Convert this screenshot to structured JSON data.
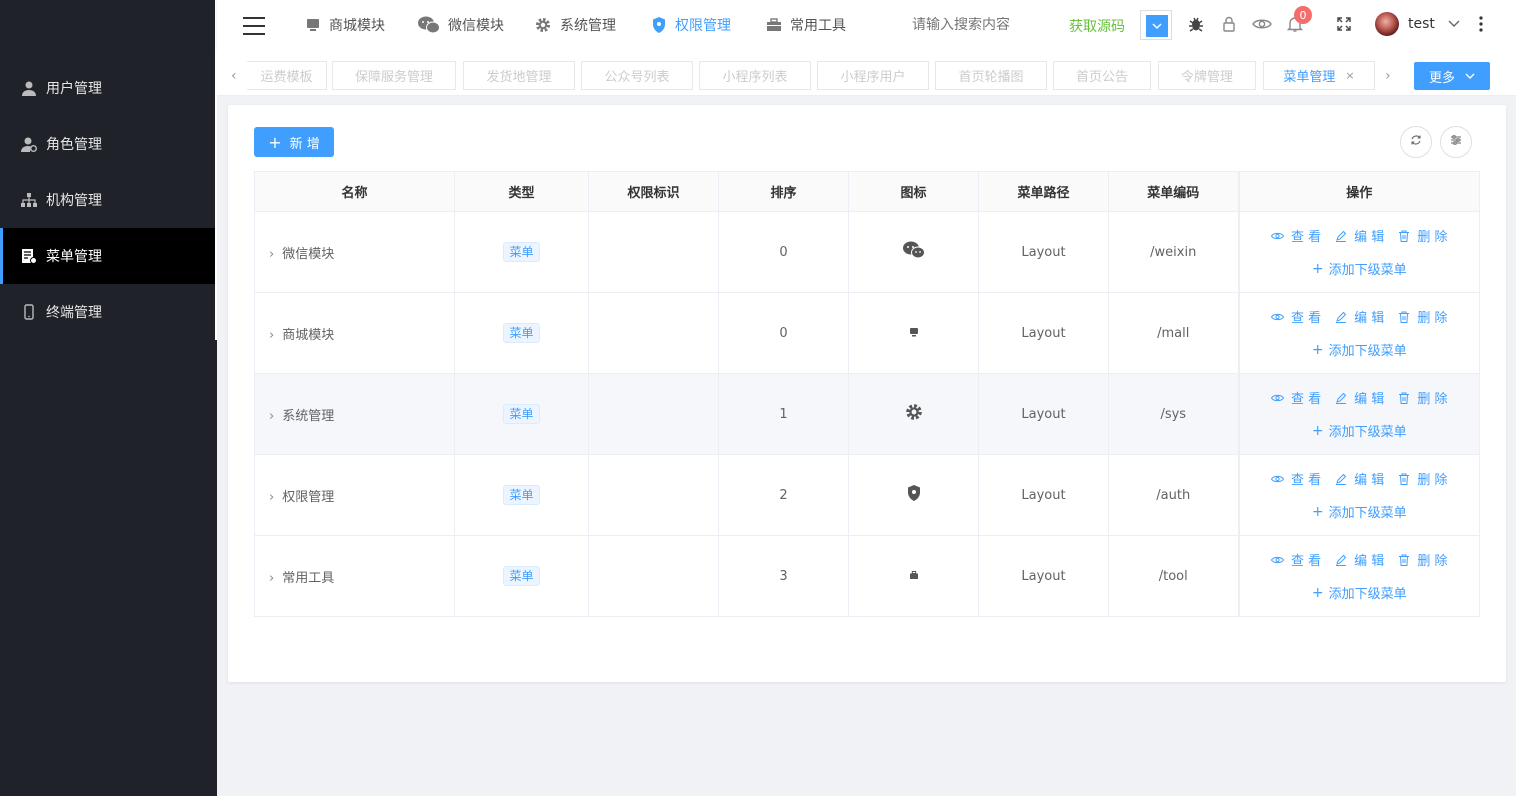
{
  "colors": {
    "primary": "#409eff",
    "success": "#67c23a",
    "danger": "#f56c6c",
    "sidebar_bg": "#20222a"
  },
  "sidebar": {
    "items": [
      {
        "label": "用户管理",
        "icon": "user-icon"
      },
      {
        "label": "角色管理",
        "icon": "role-icon"
      },
      {
        "label": "机构管理",
        "icon": "org-tree-icon"
      },
      {
        "label": "菜单管理",
        "icon": "menu-doc-icon",
        "active": true
      },
      {
        "label": "终端管理",
        "icon": "mobile-icon"
      }
    ]
  },
  "header": {
    "nav": [
      {
        "label": "商城模块",
        "icon": "monitor-icon"
      },
      {
        "label": "微信模块",
        "icon": "wechat-icon"
      },
      {
        "label": "系统管理",
        "icon": "gear-icon"
      },
      {
        "label": "权限管理",
        "icon": "shield-icon",
        "active": true
      },
      {
        "label": "常用工具",
        "icon": "toolbox-icon"
      }
    ],
    "search_placeholder": "请输入搜索内容",
    "get_source": "获取源码",
    "notification_count": "0",
    "username": "test"
  },
  "tabs": {
    "items": [
      "运费模板",
      "保障服务管理",
      "发货地管理",
      "公众号列表",
      "小程序列表",
      "小程序用户",
      "首页轮播图",
      "首页公告",
      "令牌管理",
      "菜单管理"
    ],
    "active": "菜单管理",
    "close": "×",
    "more": "更多"
  },
  "toolbar": {
    "add_label": "新 增"
  },
  "table": {
    "columns": [
      "名称",
      "类型",
      "权限标识",
      "排序",
      "图标",
      "菜单路径",
      "菜单编码",
      "操作"
    ],
    "rows": [
      {
        "name": "微信模块",
        "type": "菜单",
        "perm": "",
        "sort": "0",
        "icon": "wechat-icon",
        "path": "Layout",
        "code": "/weixin"
      },
      {
        "name": "商城模块",
        "type": "菜单",
        "perm": "",
        "sort": "0",
        "icon": "monitor-icon",
        "path": "Layout",
        "code": "/mall"
      },
      {
        "name": "系统管理",
        "type": "菜单",
        "perm": "",
        "sort": "1",
        "icon": "gear-icon",
        "path": "Layout",
        "code": "/sys"
      },
      {
        "name": "权限管理",
        "type": "菜单",
        "perm": "",
        "sort": "2",
        "icon": "shield-icon",
        "path": "Layout",
        "code": "/auth"
      },
      {
        "name": "常用工具",
        "type": "菜单",
        "perm": "",
        "sort": "3",
        "icon": "toolbox-icon",
        "path": "Layout",
        "code": "/tool"
      }
    ],
    "actions": {
      "view": "查 看",
      "edit": "编 辑",
      "delete": "删 除",
      "add_child": "添加下级菜单"
    }
  }
}
